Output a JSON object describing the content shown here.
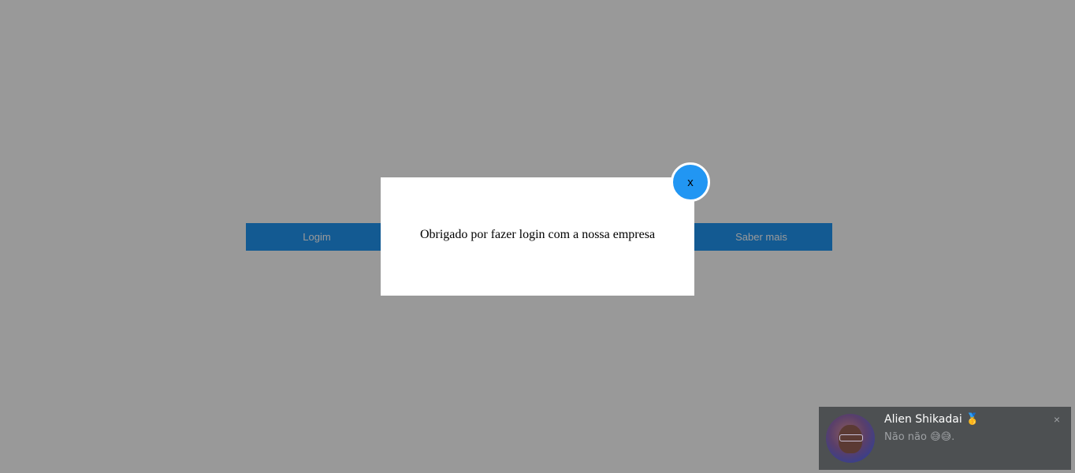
{
  "page": {
    "login_button": "Logim",
    "saber_button": "Saber mais"
  },
  "modal": {
    "message": "Obrigado por fazer login com a nossa empresa",
    "close_label": "x"
  },
  "toast": {
    "name": "Alien Shikadai 🥇",
    "message": "Não não 😅😅.",
    "close_icon": "×"
  },
  "colors": {
    "button_blue": "#2196f3",
    "overlay": "rgba(0,0,0,0.4)",
    "toast_bg": "#4d5052"
  }
}
